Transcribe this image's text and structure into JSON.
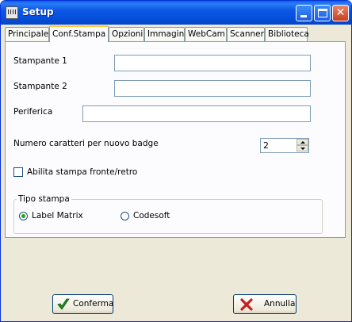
{
  "window": {
    "title": "Setup"
  },
  "tabs": [
    {
      "label": "Principale"
    },
    {
      "label": "Conf.Stampa"
    },
    {
      "label": "Opzioni"
    },
    {
      "label": "Immagini"
    },
    {
      "label": "WebCam"
    },
    {
      "label": "Scanner"
    },
    {
      "label": "Biblioteca"
    }
  ],
  "form": {
    "stampante1_label": "Stampante 1",
    "stampante1_value": "",
    "stampante2_label": "Stampante 2",
    "stampante2_value": "",
    "periferica_label": "Periferica",
    "periferica_value": "",
    "numero_caratteri_label": "Numero caratteri per nuovo badge",
    "numero_caratteri_value": "2",
    "fronte_retro_label": "Abilita stampa fronte/retro",
    "fronte_retro_checked": false,
    "tipo_stampa": {
      "title": "Tipo stampa",
      "options": [
        {
          "label": "Label Matrix",
          "selected": true
        },
        {
          "label": "Codesoft",
          "selected": false
        }
      ]
    }
  },
  "buttons": {
    "confirm_label": "Conferma",
    "cancel_label": "Annulla"
  },
  "icons": {
    "title": "app-icon",
    "confirm": "checkmark-icon",
    "cancel": "x-icon"
  },
  "colors": {
    "titlebar": "#0550dc",
    "active_tab_accent": "#ffc83c",
    "confirm_icon": "#1e8c1e",
    "cancel_icon": "#c81e1e"
  }
}
